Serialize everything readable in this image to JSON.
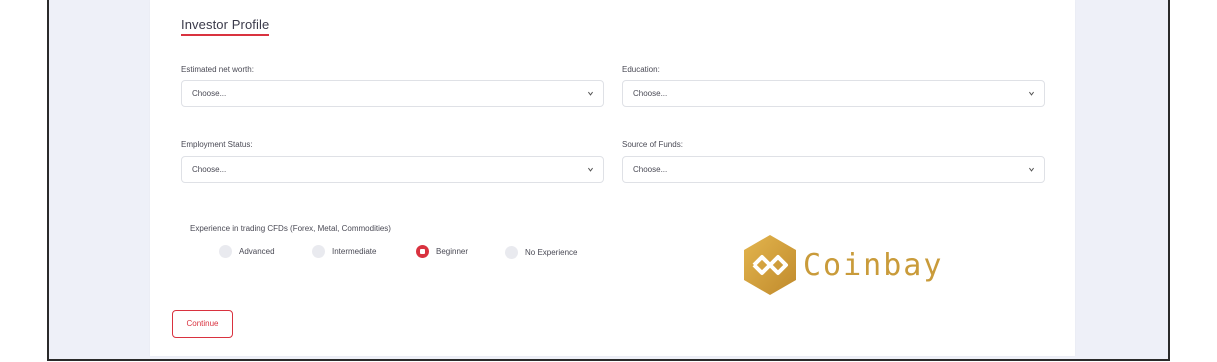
{
  "section": {
    "title": "Investor Profile"
  },
  "fields": {
    "net_worth": {
      "label": "Estimated net worth:",
      "value": "Choose..."
    },
    "education": {
      "label": "Education:",
      "value": "Choose..."
    },
    "employment": {
      "label": "Employment Status:",
      "value": "Choose..."
    },
    "source_of_funds": {
      "label": "Source of Funds:",
      "value": "Choose..."
    }
  },
  "experience": {
    "label": "Experience in trading CFDs (Forex, Metal, Commodities)",
    "options": [
      "Advanced",
      "Intermediate",
      "Beginner",
      "No Experience"
    ],
    "selected": "Beginner"
  },
  "actions": {
    "continue_label": "Continue"
  },
  "brand": {
    "name": "Coinbay"
  },
  "colors": {
    "accent": "#d9323f",
    "brand_gold": "#c99b3a",
    "page_bg": "#eef0f8"
  }
}
